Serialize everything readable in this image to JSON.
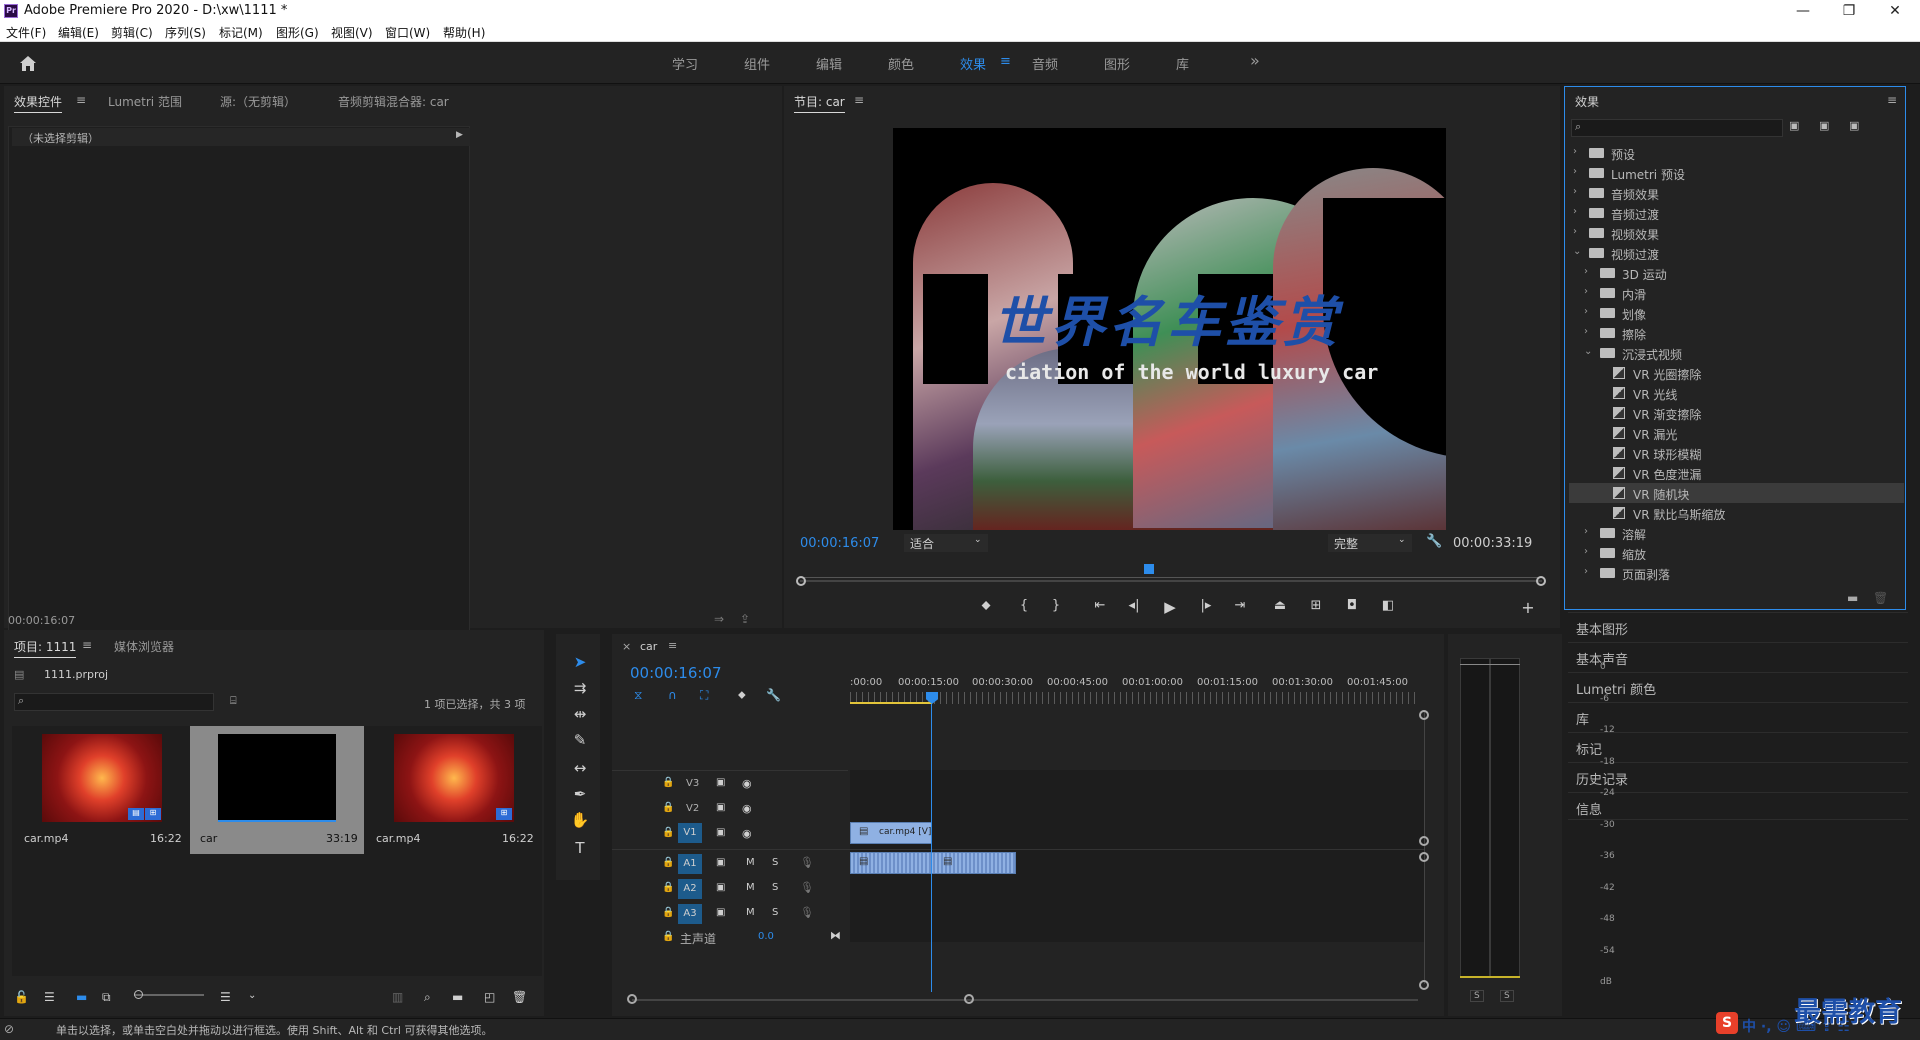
{
  "window": {
    "title": "Adobe Premiere Pro 2020 - D:\\xw\\1111 *",
    "app_icon": "Pr",
    "minimize": "—",
    "maximize": "❐",
    "close": "✕"
  },
  "menu": [
    "文件(F)",
    "编辑(E)",
    "剪辑(C)",
    "序列(S)",
    "标记(M)",
    "图形(G)",
    "视图(V)",
    "窗口(W)",
    "帮助(H)"
  ],
  "workspaces": {
    "items": [
      "学习",
      "组件",
      "编辑",
      "颜色",
      "效果",
      "音频",
      "图形",
      "库"
    ],
    "active": "效果",
    "more": "»"
  },
  "effect_controls": {
    "tabs": [
      "效果控件",
      "Lumetri 范围",
      "源:（无剪辑）",
      "音频剪辑混合器: car"
    ],
    "no_clip": "（未选择剪辑）",
    "timecode": "00:00:16:07"
  },
  "program_monitor": {
    "title": "节目: car",
    "current_time": "00:00:16:07",
    "fit": "适合",
    "quality": "完整",
    "duration": "00:00:33:19",
    "video_text_cn": "世界名车鉴赏",
    "video_text_en": "ciation of the world luxury car",
    "playhead_fraction": 0.47
  },
  "effects_panel": {
    "title": "效果",
    "tree": [
      {
        "label": "预设",
        "type": "folder-special",
        "depth": 0,
        "open": false
      },
      {
        "label": "Lumetri 预设",
        "type": "folder-special",
        "depth": 0,
        "open": false
      },
      {
        "label": "音频效果",
        "type": "folder",
        "depth": 0,
        "open": false
      },
      {
        "label": "音频过渡",
        "type": "folder",
        "depth": 0,
        "open": false
      },
      {
        "label": "视频效果",
        "type": "folder",
        "depth": 0,
        "open": false
      },
      {
        "label": "视频过渡",
        "type": "folder",
        "depth": 0,
        "open": true
      },
      {
        "label": "3D 运动",
        "type": "folder",
        "depth": 1,
        "open": false
      },
      {
        "label": "内滑",
        "type": "folder",
        "depth": 1,
        "open": false
      },
      {
        "label": "划像",
        "type": "folder",
        "depth": 1,
        "open": false
      },
      {
        "label": "擦除",
        "type": "folder",
        "depth": 1,
        "open": false
      },
      {
        "label": "沉浸式视频",
        "type": "folder",
        "depth": 1,
        "open": true
      },
      {
        "label": "VR 光圈擦除",
        "type": "effect",
        "depth": 2
      },
      {
        "label": "VR 光线",
        "type": "effect",
        "depth": 2
      },
      {
        "label": "VR 渐变擦除",
        "type": "effect",
        "depth": 2
      },
      {
        "label": "VR 漏光",
        "type": "effect",
        "depth": 2
      },
      {
        "label": "VR 球形模糊",
        "type": "effect",
        "depth": 2
      },
      {
        "label": "VR 色度泄漏",
        "type": "effect",
        "depth": 2
      },
      {
        "label": "VR 随机块",
        "type": "effect",
        "depth": 2,
        "selected": true
      },
      {
        "label": "VR 默比乌斯缩放",
        "type": "effect",
        "depth": 2
      },
      {
        "label": "溶解",
        "type": "folder",
        "depth": 1,
        "open": false
      },
      {
        "label": "缩放",
        "type": "folder",
        "depth": 1,
        "open": false
      },
      {
        "label": "页面剥落",
        "type": "folder",
        "depth": 1,
        "open": false
      }
    ]
  },
  "side_panels": [
    "基本图形",
    "基本声音",
    "Lumetri 颜色",
    "库",
    "标记",
    "历史记录",
    "信息"
  ],
  "project": {
    "tabs": [
      "项目: 1111",
      "媒体浏览器"
    ],
    "file": "1111.prproj",
    "selection_info": "1 项已选择，共 3 项",
    "items": [
      {
        "name": "car.mp4",
        "duration": "16:22",
        "selected": false,
        "thumb": "red"
      },
      {
        "name": "car",
        "duration": "33:19",
        "selected": true,
        "thumb": "black"
      },
      {
        "name": "car.mp4",
        "duration": "16:22",
        "selected": false,
        "thumb": "red"
      }
    ]
  },
  "timeline": {
    "sequence": "car",
    "close": "×",
    "timecode": "00:00:16:07",
    "ruler": [
      ":00:00",
      "00:00:15:00",
      "00:00:30:00",
      "00:00:45:00",
      "00:01:00:00",
      "00:01:15:00",
      "00:01:30:00",
      "00:01:45:00"
    ],
    "tracks_video": [
      "V3",
      "V2",
      "V1"
    ],
    "tracks_audio": [
      "A1",
      "A2",
      "A3"
    ],
    "master": "主声道",
    "master_value": "0.0",
    "clip_video": "car.mp4 [V]",
    "mute": "M",
    "solo": "S"
  },
  "meter": {
    "labels": [
      "0",
      "-6",
      "-12",
      "-18",
      "-24",
      "-30",
      "-36",
      "-42",
      "-48",
      "-54",
      "dB"
    ],
    "solo_left": "S",
    "solo_right": "S"
  },
  "status": "单击以选择，或单击空白处并拖动以进行框选。使用 Shift、Alt 和 Ctrl 可获得其他选项。",
  "watermark": "最需教育",
  "colors": {
    "accent": "#2d8ceb",
    "panel": "#232323",
    "bg": "#1d1d1d",
    "clip": "#8fb1e3"
  }
}
